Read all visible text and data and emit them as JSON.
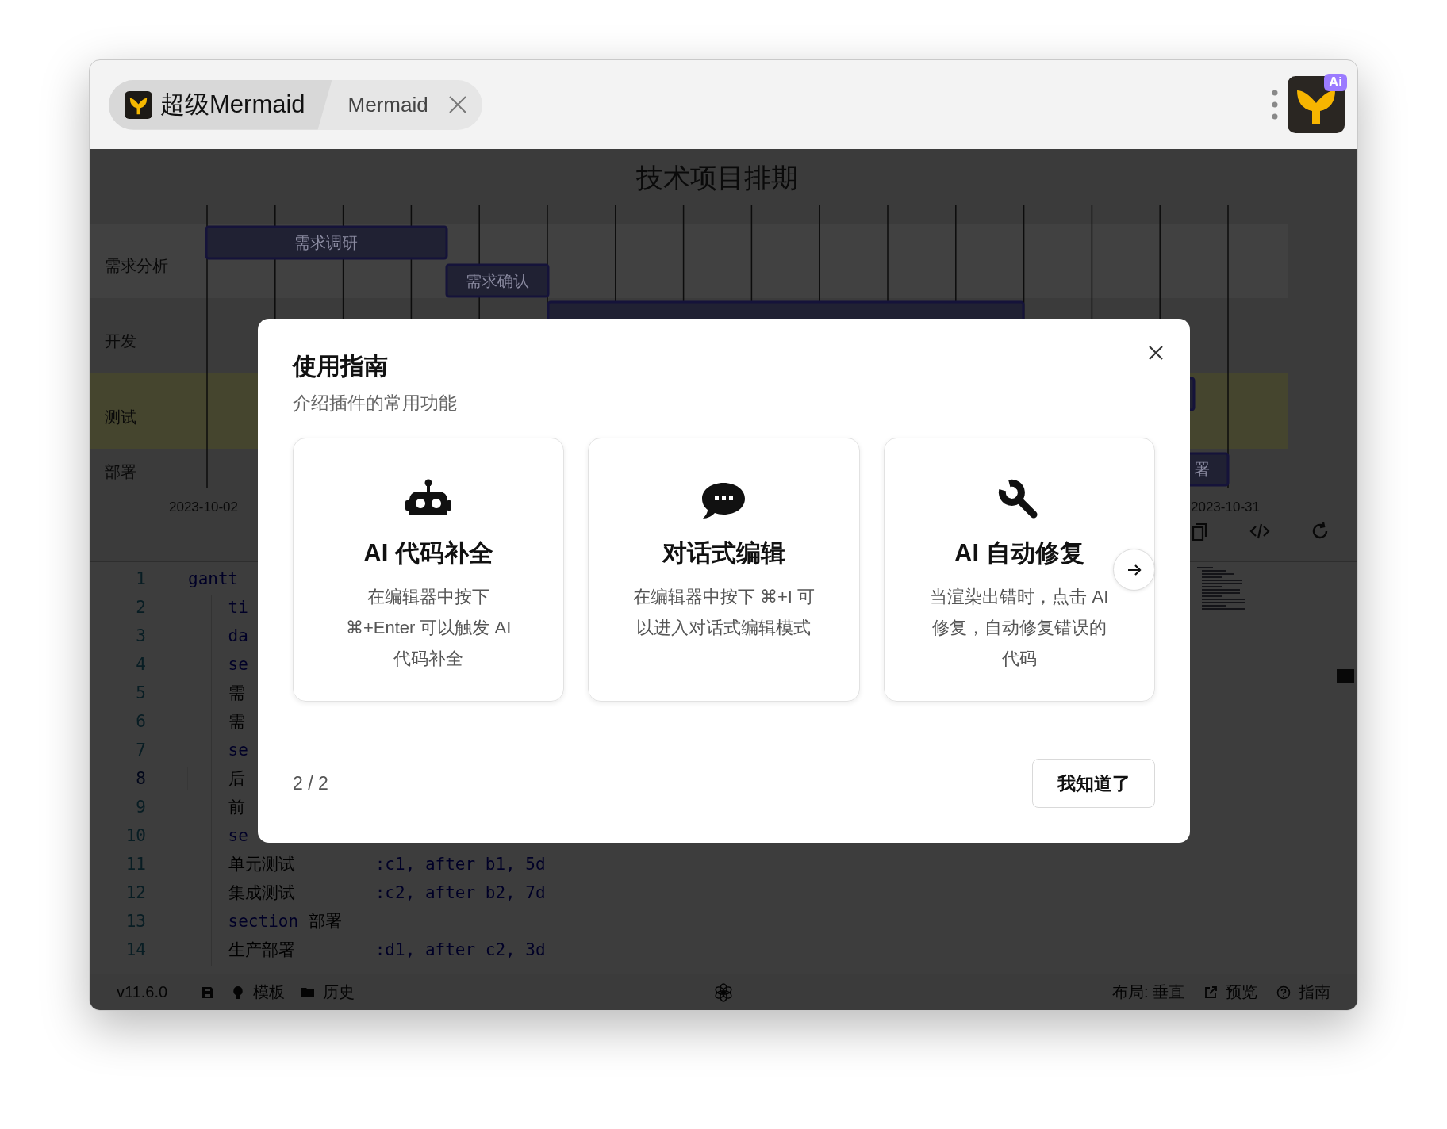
{
  "window": {
    "tabs": [
      {
        "label": "超级Mermaid",
        "selected": true
      },
      {
        "label": "Mermaid",
        "selected": false
      }
    ],
    "app_badge": "Ai"
  },
  "gantt": {
    "title": "技术项目排期",
    "sections": [
      {
        "label": "需求分析"
      },
      {
        "label": "开发"
      },
      {
        "label": "测试"
      },
      {
        "label": "部署"
      }
    ],
    "tasks": [
      {
        "label": "需求调研"
      },
      {
        "label": "需求确认"
      },
      {
        "label": "署"
      }
    ],
    "axis_labels": [
      "2023-10-02",
      "2023-10-31"
    ]
  },
  "editor": {
    "lines": [
      {
        "number": "1",
        "current": false,
        "segments": [
          {
            "text": "gantt",
            "kind": "keyword"
          }
        ]
      },
      {
        "number": "2",
        "current": false,
        "segments": [
          {
            "text": "    ti",
            "kind": "keyword"
          }
        ]
      },
      {
        "number": "3",
        "current": false,
        "segments": [
          {
            "text": "    da",
            "kind": "keyword"
          }
        ]
      },
      {
        "number": "4",
        "current": false,
        "segments": [
          {
            "text": "    se",
            "kind": "keyword"
          }
        ]
      },
      {
        "number": "5",
        "current": false,
        "segments": [
          {
            "text": "    需",
            "kind": "plain"
          }
        ]
      },
      {
        "number": "6",
        "current": false,
        "segments": [
          {
            "text": "    需",
            "kind": "plain"
          }
        ]
      },
      {
        "number": "7",
        "current": false,
        "segments": [
          {
            "text": "    se",
            "kind": "keyword"
          }
        ]
      },
      {
        "number": "8",
        "current": true,
        "segments": [
          {
            "text": "    后",
            "kind": "plain"
          }
        ]
      },
      {
        "number": "9",
        "current": false,
        "segments": [
          {
            "text": "    前",
            "kind": "plain"
          }
        ]
      },
      {
        "number": "10",
        "current": false,
        "segments": [
          {
            "text": "    se",
            "kind": "keyword"
          }
        ]
      },
      {
        "number": "11",
        "current": false,
        "segments": [
          {
            "text": "    单元测试        ",
            "kind": "plain"
          },
          {
            "text": ":c1, after b1, 5d",
            "kind": "keyword"
          }
        ]
      },
      {
        "number": "12",
        "current": false,
        "segments": [
          {
            "text": "    集成测试        ",
            "kind": "plain"
          },
          {
            "text": ":c2, after b2, 7d",
            "kind": "keyword"
          }
        ]
      },
      {
        "number": "13",
        "current": false,
        "segments": [
          {
            "text": "    section",
            "kind": "keyword"
          },
          {
            "text": " 部署",
            "kind": "plain"
          }
        ]
      },
      {
        "number": "14",
        "current": false,
        "segments": [
          {
            "text": "    生产部署        ",
            "kind": "plain"
          },
          {
            "text": ":d1, after c2, 3d",
            "kind": "keyword"
          }
        ]
      }
    ]
  },
  "status_bar": {
    "version": "v11.6.0",
    "templates": "模板",
    "history": "历史",
    "layout": "布局: 垂直",
    "preview": "预览",
    "guide": "指南"
  },
  "modal": {
    "title": "使用指南",
    "subtitle": "介绍插件的常用功能",
    "cards": [
      {
        "kind": "completion",
        "title": "AI 代码补全",
        "lines": [
          "在编辑器中按下",
          "⌘+Enter 可以触发 AI",
          "代码补全"
        ]
      },
      {
        "kind": "chat",
        "title": "对话式编辑",
        "lines": [
          "在编辑器中按下 ⌘+I 可",
          "以进入对话式编辑模式"
        ]
      },
      {
        "kind": "repair",
        "title": "AI 自动修复",
        "lines": [
          "当渲染出错时，点击 AI",
          "修复，自动修复错误的",
          "代码"
        ]
      }
    ],
    "page": "2 / 2",
    "confirm": "我知道了"
  }
}
